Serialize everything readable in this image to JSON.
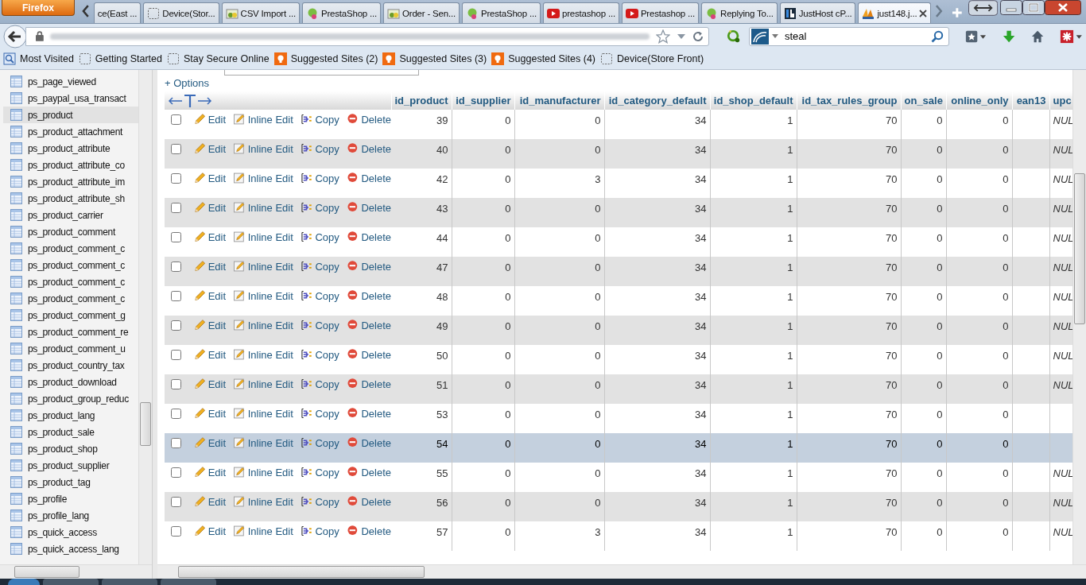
{
  "browser": {
    "app_button": "Firefox",
    "tabs": [
      {
        "label": "ce(East ...",
        "kind": "none",
        "selected": false
      },
      {
        "label": "Device(Stor...",
        "kind": "blank",
        "selected": false
      },
      {
        "label": "CSV Import ...",
        "kind": "shop",
        "selected": false
      },
      {
        "label": "PrestaShop ...",
        "kind": "presta",
        "selected": false
      },
      {
        "label": "Order - Sen...",
        "kind": "shop",
        "selected": false
      },
      {
        "label": "PrestaShop ...",
        "kind": "presta",
        "selected": false
      },
      {
        "label": "prestashop ...",
        "kind": "video",
        "selected": false
      },
      {
        "label": "Prestashop ...",
        "kind": "video",
        "selected": false
      },
      {
        "label": "Replying To...",
        "kind": "presta",
        "selected": false
      },
      {
        "label": "JustHost cP...",
        "kind": "host",
        "selected": false
      },
      {
        "label": "just148.j...",
        "kind": "pma",
        "selected": true
      }
    ],
    "search": {
      "value": "steal"
    },
    "bookmarks": [
      {
        "label": "Most Visited",
        "kind": "visited"
      },
      {
        "label": "Getting Started",
        "kind": "blank"
      },
      {
        "label": "Stay Secure Online",
        "kind": "blank"
      },
      {
        "label": "Suggested Sites (2)",
        "kind": "suggested"
      },
      {
        "label": "Suggested Sites (3)",
        "kind": "suggested"
      },
      {
        "label": "Suggested Sites (4)",
        "kind": "suggested"
      },
      {
        "label": "Device(Store Front)",
        "kind": "blank"
      }
    ]
  },
  "sidebar": {
    "items": [
      {
        "label": "ps_page_viewed",
        "selected": false
      },
      {
        "label": "ps_paypal_usa_transact",
        "selected": false
      },
      {
        "label": "ps_product",
        "selected": true
      },
      {
        "label": "ps_product_attachment",
        "selected": false
      },
      {
        "label": "ps_product_attribute",
        "selected": false
      },
      {
        "label": "ps_product_attribute_co",
        "selected": false
      },
      {
        "label": "ps_product_attribute_im",
        "selected": false
      },
      {
        "label": "ps_product_attribute_sh",
        "selected": false
      },
      {
        "label": "ps_product_carrier",
        "selected": false
      },
      {
        "label": "ps_product_comment",
        "selected": false
      },
      {
        "label": "ps_product_comment_c",
        "selected": false
      },
      {
        "label": "ps_product_comment_c",
        "selected": false
      },
      {
        "label": "ps_product_comment_c",
        "selected": false
      },
      {
        "label": "ps_product_comment_c",
        "selected": false
      },
      {
        "label": "ps_product_comment_g",
        "selected": false
      },
      {
        "label": "ps_product_comment_re",
        "selected": false
      },
      {
        "label": "ps_product_comment_u",
        "selected": false
      },
      {
        "label": "ps_product_country_tax",
        "selected": false
      },
      {
        "label": "ps_product_download",
        "selected": false
      },
      {
        "label": "ps_product_group_reduc",
        "selected": false
      },
      {
        "label": "ps_product_lang",
        "selected": false
      },
      {
        "label": "ps_product_sale",
        "selected": false
      },
      {
        "label": "ps_product_shop",
        "selected": false
      },
      {
        "label": "ps_product_supplier",
        "selected": false
      },
      {
        "label": "ps_product_tag",
        "selected": false
      },
      {
        "label": "ps_profile",
        "selected": false
      },
      {
        "label": "ps_profile_lang",
        "selected": false
      },
      {
        "label": "ps_quick_access",
        "selected": false
      },
      {
        "label": "ps_quick_access_lang",
        "selected": false
      }
    ]
  },
  "options_link": "+ Options",
  "table": {
    "columns": [
      "id_product",
      "id_supplier",
      "id_manufacturer",
      "id_category_default",
      "id_shop_default",
      "id_tax_rules_group",
      "on_sale",
      "online_only",
      "ean13",
      "upc"
    ],
    "rows": [
      {
        "checked": false,
        "highlighted": false,
        "actions": [
          "Edit",
          "Inline Edit",
          "Copy",
          "Delete"
        ],
        "cells": [
          "39",
          "0",
          "0",
          "34",
          "1",
          "70",
          "0",
          "0",
          null,
          "NUL"
        ]
      },
      {
        "checked": false,
        "highlighted": false,
        "actions": [
          "Edit",
          "Inline Edit",
          "Copy",
          "Delete"
        ],
        "cells": [
          "40",
          "0",
          "0",
          "34",
          "1",
          "70",
          "0",
          "0",
          null,
          "NUL"
        ]
      },
      {
        "checked": false,
        "highlighted": false,
        "actions": [
          "Edit",
          "Inline Edit",
          "Copy",
          "Delete"
        ],
        "cells": [
          "42",
          "0",
          "3",
          "34",
          "1",
          "70",
          "0",
          "0",
          null,
          "NUL"
        ]
      },
      {
        "checked": false,
        "highlighted": false,
        "actions": [
          "Edit",
          "Inline Edit",
          "Copy",
          "Delete"
        ],
        "cells": [
          "43",
          "0",
          "0",
          "34",
          "1",
          "70",
          "0",
          "0",
          null,
          "NUL"
        ]
      },
      {
        "checked": false,
        "highlighted": false,
        "actions": [
          "Edit",
          "Inline Edit",
          "Copy",
          "Delete"
        ],
        "cells": [
          "44",
          "0",
          "0",
          "34",
          "1",
          "70",
          "0",
          "0",
          null,
          "NUL"
        ]
      },
      {
        "checked": false,
        "highlighted": false,
        "actions": [
          "Edit",
          "Inline Edit",
          "Copy",
          "Delete"
        ],
        "cells": [
          "47",
          "0",
          "0",
          "34",
          "1",
          "70",
          "0",
          "0",
          null,
          "NUL"
        ]
      },
      {
        "checked": false,
        "highlighted": false,
        "actions": [
          "Edit",
          "Inline Edit",
          "Copy",
          "Delete"
        ],
        "cells": [
          "48",
          "0",
          "0",
          "34",
          "1",
          "70",
          "0",
          "0",
          null,
          "NUL"
        ]
      },
      {
        "checked": false,
        "highlighted": false,
        "actions": [
          "Edit",
          "Inline Edit",
          "Copy",
          "Delete"
        ],
        "cells": [
          "49",
          "0",
          "0",
          "34",
          "1",
          "70",
          "0",
          "0",
          null,
          "NUL"
        ]
      },
      {
        "checked": false,
        "highlighted": false,
        "actions": [
          "Edit",
          "Inline Edit",
          "Copy",
          "Delete"
        ],
        "cells": [
          "50",
          "0",
          "0",
          "34",
          "1",
          "70",
          "0",
          "0",
          null,
          "NUL"
        ]
      },
      {
        "checked": false,
        "highlighted": false,
        "actions": [
          "Edit",
          "Inline Edit",
          "Copy",
          "Delete"
        ],
        "cells": [
          "51",
          "0",
          "0",
          "34",
          "1",
          "70",
          "0",
          "0",
          null,
          "NUL"
        ]
      },
      {
        "checked": false,
        "highlighted": false,
        "actions": [
          "Edit",
          "Inline Edit",
          "Copy",
          "Delete"
        ],
        "cells": [
          "53",
          "0",
          "0",
          "34",
          "1",
          "70",
          "0",
          "0",
          null,
          null
        ]
      },
      {
        "checked": false,
        "highlighted": true,
        "actions": [
          "Edit",
          "Inline Edit",
          "Copy",
          "Delete"
        ],
        "cells": [
          "54",
          "0",
          "0",
          "34",
          "1",
          "70",
          "0",
          "0",
          null,
          null
        ]
      },
      {
        "checked": false,
        "highlighted": false,
        "actions": [
          "Edit",
          "Inline Edit",
          "Copy",
          "Delete"
        ],
        "cells": [
          "55",
          "0",
          "0",
          "34",
          "1",
          "70",
          "0",
          "0",
          null,
          "NUL"
        ]
      },
      {
        "checked": false,
        "highlighted": false,
        "actions": [
          "Edit",
          "Inline Edit",
          "Copy",
          "Delete"
        ],
        "cells": [
          "56",
          "0",
          "0",
          "34",
          "1",
          "70",
          "0",
          "0",
          null,
          "NUL"
        ]
      },
      {
        "checked": false,
        "highlighted": false,
        "actions": [
          "Edit",
          "Inline Edit",
          "Copy",
          "Delete"
        ],
        "cells": [
          "57",
          "0",
          "3",
          "34",
          "1",
          "70",
          "0",
          "0",
          null,
          "NUL"
        ]
      }
    ]
  }
}
